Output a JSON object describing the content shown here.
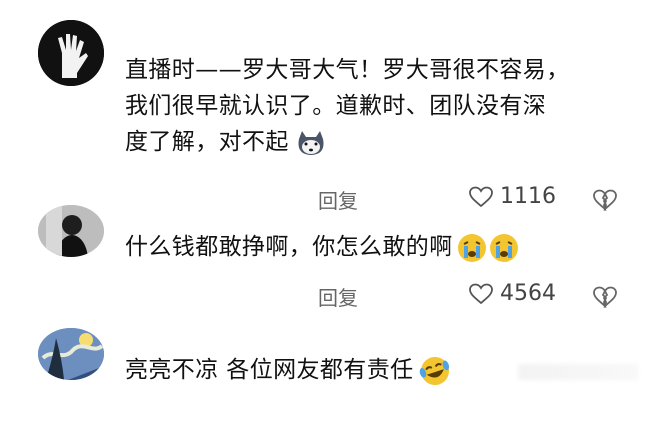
{
  "comments": [
    {
      "username": "",
      "text_lines": [
        "直播时——罗大哥大气！罗大哥很不容易，",
        "我们很早就认识了。道歉时、团队没有深",
        "度了解，对不起"
      ],
      "meta": "",
      "reply_label": "回复",
      "likes": "1116",
      "avatar": "hand-avatar",
      "emoji": "husky-emoji"
    },
    {
      "username": "",
      "text_lines": [
        "什么钱都敢挣啊，你怎么敢的啊"
      ],
      "meta": "",
      "reply_label": "回复",
      "likes": "4564",
      "avatar": "photo-avatar",
      "emoji": "crying-emoji"
    },
    {
      "username": "",
      "text_lines": [
        "亮亮不凉 各位网友都有责任"
      ],
      "avatar": "starry-night-avatar",
      "emoji": "laughing-tears-emoji"
    }
  ],
  "colors": {
    "text": "#111111",
    "meta": "#8e8e8e",
    "emoji_yellow": "#f2c531"
  }
}
